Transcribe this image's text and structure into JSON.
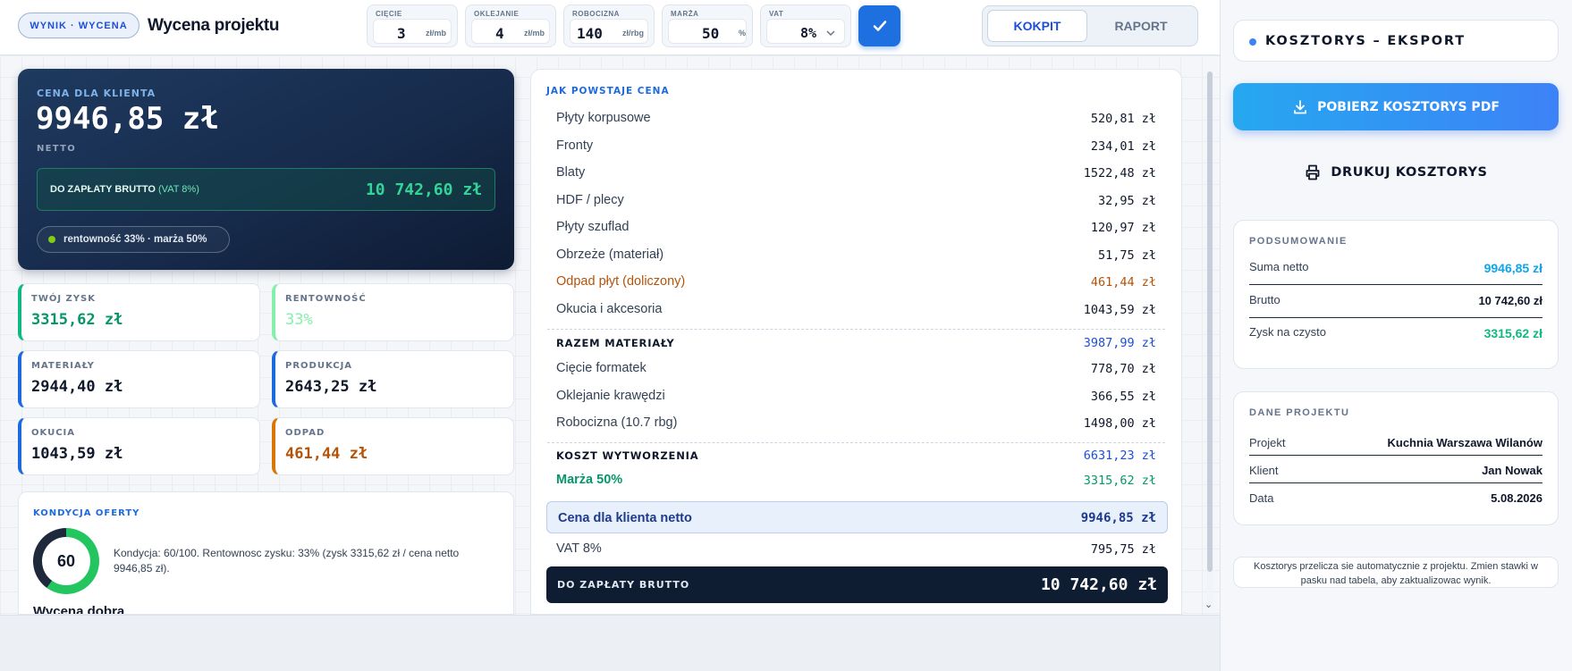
{
  "header": {
    "badge": "WYNIK · WYCENA",
    "title": "Wycena projektu",
    "rates": [
      {
        "label": "CIĘCIE",
        "value": "3",
        "unit": "zł/mb"
      },
      {
        "label": "OKLEJANIE",
        "value": "4",
        "unit": "zł/mb"
      },
      {
        "label": "ROBOCIZNA",
        "value": "140",
        "unit": "zł/rbg"
      },
      {
        "label": "MARŻA",
        "value": "50",
        "unit": "%"
      }
    ],
    "vat": {
      "label": "VAT",
      "value": "8%"
    },
    "confirm_icon": "checkmark-icon",
    "tabs": [
      "KOKPIT",
      "RAPORT"
    ],
    "active_tab": "KOKPIT"
  },
  "hero": {
    "label": "CENA DLA KLIENTA",
    "price": "9946,85 zł",
    "netto": "NETTO",
    "brutto_label": "DO ZAPŁATY BRUTTO",
    "brutto_vat": "(VAT 8%)",
    "brutto_value": "10 742,60 zł",
    "chip": "rentowność 33% · marża 50%"
  },
  "cards": [
    {
      "label": "TWÓJ ZYSK",
      "value": "3315,62 zł",
      "color": "#059669"
    },
    {
      "label": "RENTOWNOŚĆ",
      "value": "33%",
      "color": "#86efac"
    },
    {
      "label": "MATERIAŁY",
      "value": "2944,40 zł",
      "color": "#0f172a"
    },
    {
      "label": "PRODUKCJA",
      "value": "2643,25 zł",
      "color": "#0f172a"
    },
    {
      "label": "OKUCIA",
      "value": "1043,59 zł",
      "color": "#0f172a"
    },
    {
      "label": "ODPAD",
      "value": "461,44 zł",
      "color": "#b45309"
    }
  ],
  "kondycja": {
    "label": "KONDYCJA OFERTY",
    "score": "60",
    "score_fraction": 0.6,
    "text": "Kondycja: 60/100. Rentownosc zysku: 33% (zysk 3315,62 zł / cena netto 9946,85 zł).",
    "verdict": "Wycena dobra"
  },
  "breakdown": {
    "title": "JAK POWSTAJE CENA",
    "rows": [
      {
        "name": "Płyty korpusowe",
        "value": "520,81 zł"
      },
      {
        "name": "Fronty",
        "value": "234,01 zł"
      },
      {
        "name": "Blaty",
        "value": "1522,48 zł"
      },
      {
        "name": "HDF / plecy",
        "value": "32,95 zł"
      },
      {
        "name": "Płyty szuflad",
        "value": "120,97 zł"
      },
      {
        "name": "Obrzeże (materiał)",
        "value": "51,75 zł"
      },
      {
        "name": "Odpad płyt (doliczony)",
        "value": "461,44 zł"
      },
      {
        "name": "Okucia i akcesoria",
        "value": "1043,59 zł"
      },
      {
        "name": "RAZEM MATERIAŁY",
        "value": "3987,99 zł"
      },
      {
        "name": "Cięcie formatek",
        "value": "778,70 zł"
      },
      {
        "name": "Oklejanie krawędzi",
        "value": "366,55 zł"
      },
      {
        "name": "Robocizna (10.7 rbg)",
        "value": "1498,00 zł"
      },
      {
        "name": "KOSZT WYTWORZENIA",
        "value": "6631,23 zł"
      },
      {
        "name": "Marża 50%",
        "value": "3315,62 zł"
      }
    ],
    "net": {
      "name": "Cena dla klienta netto",
      "value": "9946,85 zł"
    },
    "vat": {
      "name": "VAT 8%",
      "value": "795,75 zł"
    },
    "brutto": {
      "name": "DO ZAPŁATY BRUTTO",
      "value": "10 742,60 zł"
    }
  },
  "sidebar": {
    "export_title": "KOSZTORYS – EKSPORT",
    "pdf_button": "POBIERZ KOSZTORYS PDF",
    "print_button": "DRUKUJ KOSZTORYS",
    "summary": {
      "label": "PODSUMOWANIE",
      "rows": [
        {
          "name": "Suma netto",
          "value": "9946,85 zł",
          "color": "#0ea5e9"
        },
        {
          "name": "Brutto",
          "value": "10 742,60 zł",
          "color": "#0f172a"
        },
        {
          "name": "Zysk na czysto",
          "value": "3315,62 zł",
          "color": "#10b981"
        }
      ]
    },
    "project": {
      "label": "DANE PROJEKTU",
      "rows": [
        {
          "name": "Projekt",
          "value": "Kuchnia Warszawa Wilanów"
        },
        {
          "name": "Klient",
          "value": "Jan Nowak"
        },
        {
          "name": "Data",
          "value": "5.08.2026"
        }
      ]
    },
    "note": "Kosztorys przelicza sie automatycznie z projektu. Zmien stawki w pasku nad tabela, aby zaktualizowac wynik."
  }
}
